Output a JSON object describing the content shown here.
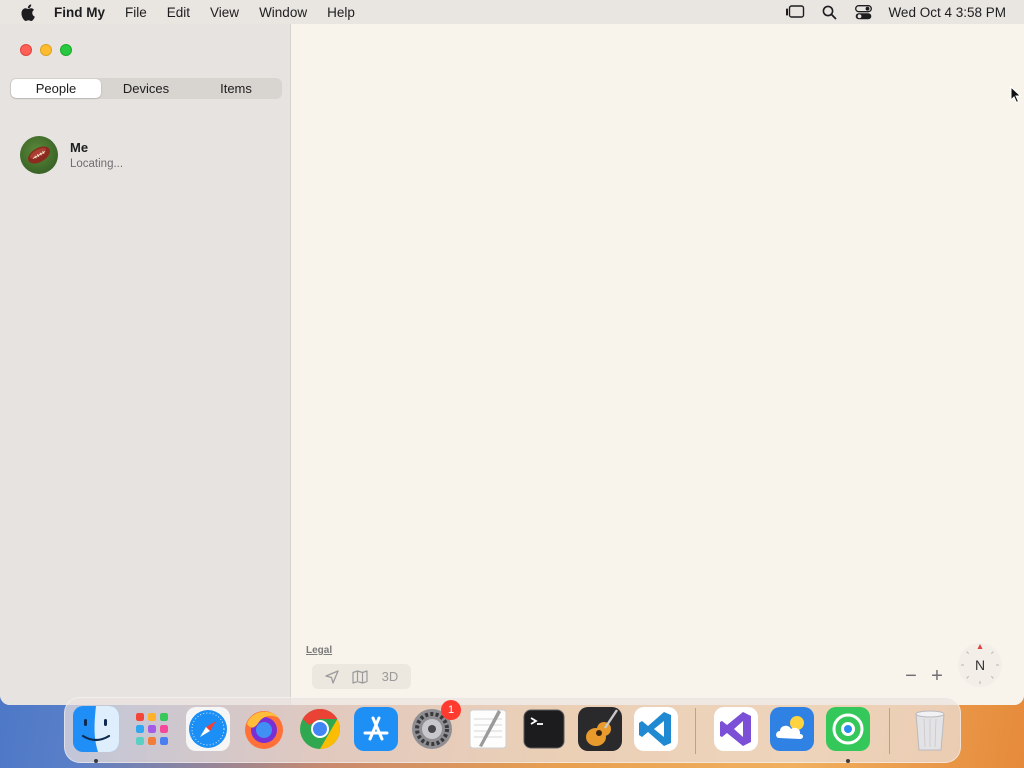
{
  "menubar": {
    "app_name": "Find My",
    "menus": [
      "File",
      "Edit",
      "View",
      "Window",
      "Help"
    ],
    "clock": "Wed Oct 4  3:58 PM"
  },
  "sidebar": {
    "tabs": [
      {
        "label": "People",
        "active": true
      },
      {
        "label": "Devices",
        "active": false
      },
      {
        "label": "Items",
        "active": false
      }
    ],
    "people": [
      {
        "name": "Me",
        "status": "Locating..."
      }
    ]
  },
  "map": {
    "legal_label": "Legal",
    "view_3d_label": "3D",
    "zoom_out_label": "−",
    "zoom_in_label": "+",
    "compass_label": "N"
  },
  "dock": {
    "items": [
      "Finder",
      "Launchpad",
      "Safari",
      "Firefox",
      "Chrome",
      "App Store",
      "System Settings",
      "TextEdit",
      "Terminal",
      "GarageBand",
      "Visual Studio Code",
      "Visual Studio",
      "Weather",
      "Find My",
      "Trash"
    ],
    "system_settings_badge": "1"
  },
  "colors": {
    "map_background": "#f8f4ec",
    "sidebar_background": "#e6e3e0",
    "badge": "#ff3b30"
  }
}
